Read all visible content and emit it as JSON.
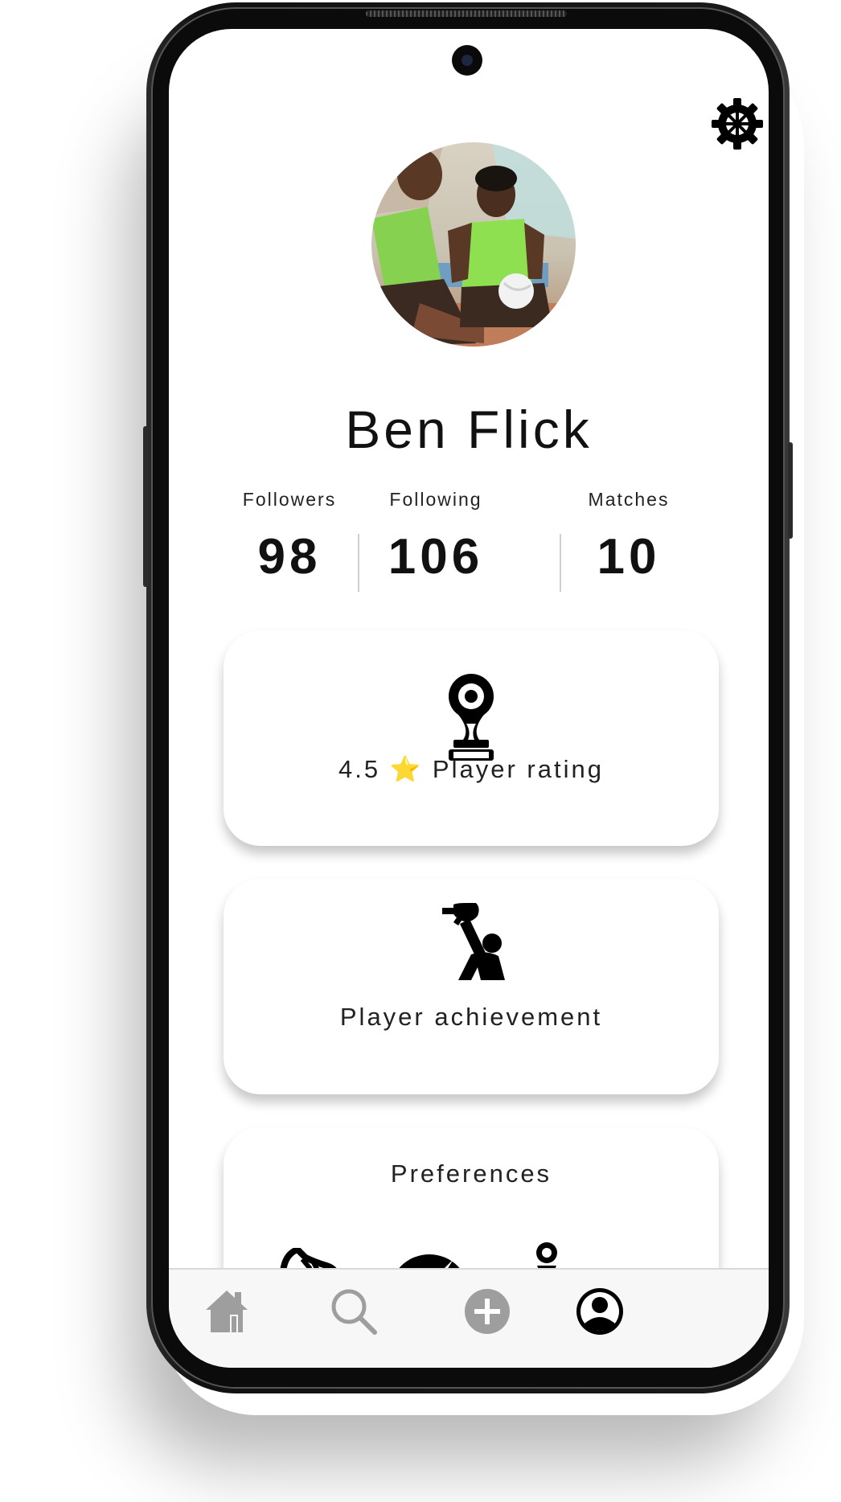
{
  "profile": {
    "name": "Ben Flick"
  },
  "stats": [
    {
      "label": "Followers",
      "value": "98"
    },
    {
      "label": "Following",
      "value": "106"
    },
    {
      "label": "Matches",
      "value": "10"
    }
  ],
  "rating_card": {
    "label": "4.5 ⭐ Player rating",
    "icon": "trophy-icon"
  },
  "achievement_card": {
    "label": "Player achievement",
    "icon": "trophy-raise-icon"
  },
  "preferences_card": {
    "title": "Preferences",
    "icons": [
      "boot-icon",
      "ball-icon",
      "pawn-icon"
    ]
  },
  "nav": {
    "items": [
      "home-icon",
      "search-icon",
      "add-icon",
      "profile-icon"
    ],
    "active": "profile-icon"
  },
  "colors": {
    "nav_inactive": "#9e9e9e",
    "nav_active": "#000000",
    "card_bg": "#ffffff"
  }
}
